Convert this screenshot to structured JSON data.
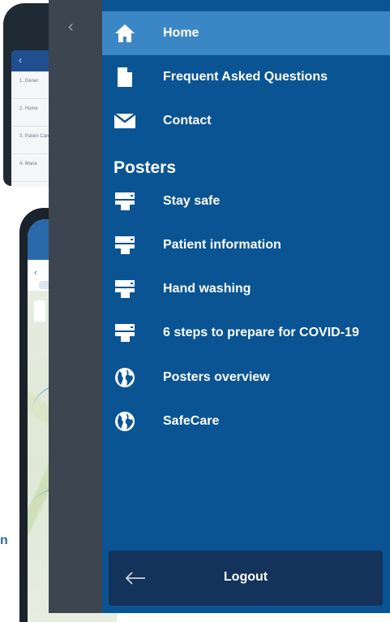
{
  "background": {
    "top_phone_list": [
      "1. Gener",
      "2. Hume",
      "3. Patien Care",
      "4. Mana"
    ],
    "edge_text": "n"
  },
  "drawer": {
    "items": [
      {
        "label": "Home",
        "icon": "home-icon",
        "active": true
      },
      {
        "label": "Frequent Asked Questions",
        "icon": "document-icon",
        "active": false
      },
      {
        "label": "Contact",
        "icon": "mail-icon",
        "active": false
      }
    ],
    "section_title": "Posters",
    "poster_items": [
      {
        "label": "Stay safe",
        "icon": "printer-icon"
      },
      {
        "label": "Patient information",
        "icon": "printer-icon"
      },
      {
        "label": "Hand washing",
        "icon": "printer-icon"
      },
      {
        "label": "6 steps to prepare for COVID-19",
        "icon": "printer-icon"
      },
      {
        "label": "Posters overview",
        "icon": "globe-icon"
      },
      {
        "label": "SafeCare",
        "icon": "globe-icon"
      }
    ],
    "logout_label": "Logout"
  },
  "colors": {
    "drawer_bg": "#0a5494",
    "active_bg": "#3b87c6",
    "logout_bg": "#14335a"
  }
}
